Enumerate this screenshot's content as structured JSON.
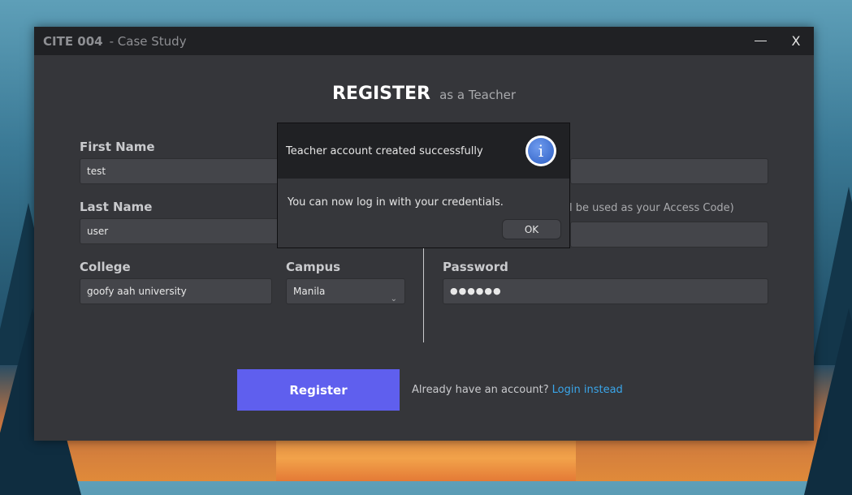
{
  "window": {
    "app_title": "CITE 004",
    "subtitle": "- Case Study",
    "minimize_icon": "minimize-icon",
    "close_label": "X"
  },
  "heading": {
    "main": "REGISTER",
    "sub": "as a Teacher"
  },
  "form": {
    "first_name": {
      "label": "First Name",
      "value": "test"
    },
    "last_name": {
      "label": "Last Name",
      "value": "user"
    },
    "college": {
      "label": "College",
      "value": "goofy aah university"
    },
    "campus": {
      "label": "Campus",
      "value": "Manila"
    },
    "right_top": {
      "value": ""
    },
    "access_code_hint": "l be used as your Access Code)",
    "right_mid": {
      "value": ""
    },
    "password": {
      "label": "Password",
      "value": "●●●●●●"
    }
  },
  "actions": {
    "register_label": "Register",
    "account_prompt": "Already have an account?",
    "login_link": "Login instead"
  },
  "dialog": {
    "title": "Teacher account created successfully",
    "icon_letter": "i",
    "message": "You can now log in with your credentials.",
    "ok_label": "OK"
  },
  "colors": {
    "accent": "#5f5fee",
    "link": "#3aa6ea",
    "window_bg": "#35363a",
    "titlebar_bg": "#202124"
  }
}
